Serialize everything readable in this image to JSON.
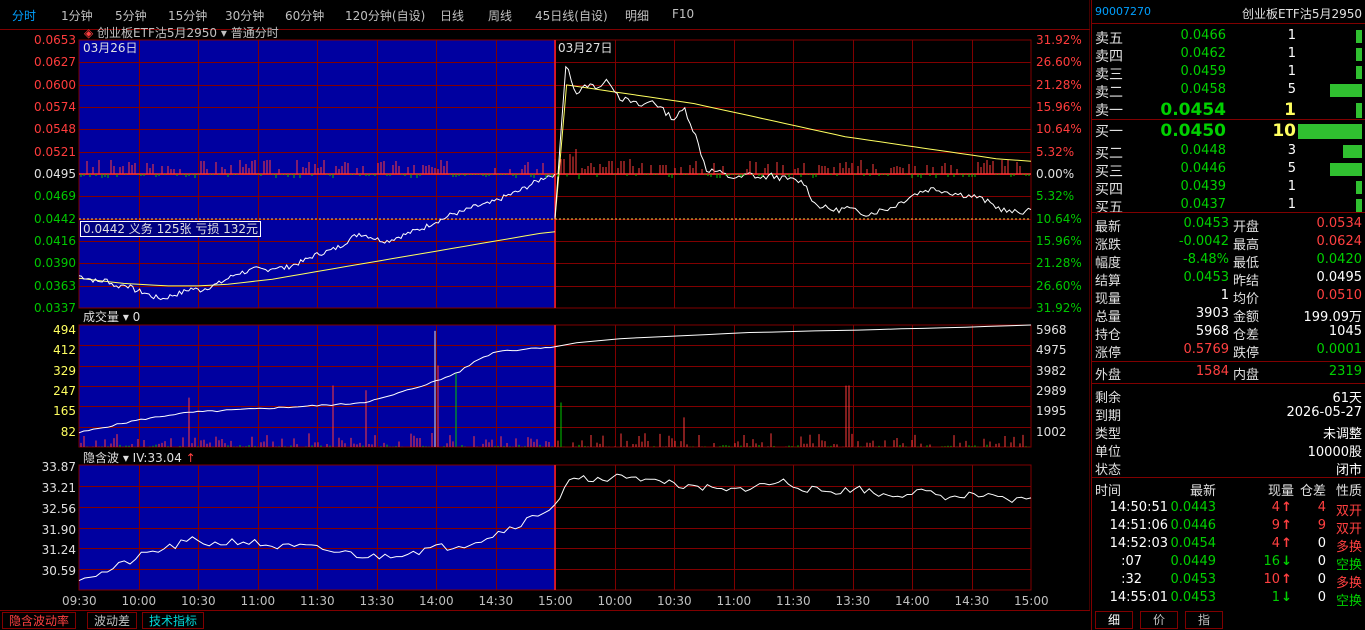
{
  "toolbar": {
    "tabs": [
      "分时",
      "1分钟",
      "5分钟",
      "15分钟",
      "30分钟",
      "60分钟",
      "120分钟(自设)",
      "日线",
      "周线",
      "45日线(自设)",
      "明细",
      "F10"
    ],
    "active": 0
  },
  "chart_header": {
    "contract_name": "创业板ETF沽5月2950",
    "mode": "普通分时",
    "date_left": "03月26日",
    "date_right": "03月27日"
  },
  "crosshair_box": "0.0442 义务 125张 亏损 132元",
  "chart_data": [
    {
      "type": "line",
      "name": "price",
      "y_ticks": [
        "0.0653",
        "0.0627",
        "0.0600",
        "0.0574",
        "0.0548",
        "0.0521",
        "0.0495",
        "0.0469",
        "0.0442",
        "0.0416",
        "0.0390",
        "0.0363",
        "0.0337"
      ],
      "pct_ticks": [
        "31.92%",
        "26.60%",
        "21.28%",
        "15.96%",
        "10.64%",
        "5.32%",
        "0.00%",
        "5.32%",
        "10.64%",
        "15.96%",
        "21.28%",
        "26.60%",
        "31.92%"
      ],
      "ylim": [
        0.0337,
        0.0653
      ],
      "prev_settle": 0.0495,
      "day1_price": [
        0.0375,
        0.0372,
        0.0368,
        0.037,
        0.0362,
        0.0365,
        0.0358,
        0.0355,
        0.035,
        0.0348,
        0.0352,
        0.0355,
        0.036,
        0.0358,
        0.0362,
        0.0366,
        0.0372,
        0.0378,
        0.038,
        0.0383,
        0.0382,
        0.0385,
        0.0384,
        0.0388,
        0.0392,
        0.0398,
        0.0402,
        0.0405,
        0.041,
        0.0418,
        0.0425,
        0.0422,
        0.0418,
        0.0416,
        0.042,
        0.0424,
        0.0428,
        0.0432,
        0.0438,
        0.0442,
        0.0448,
        0.045,
        0.0455,
        0.0458,
        0.046,
        0.0465,
        0.047,
        0.0474,
        0.048,
        0.0486,
        0.0492,
        0.0495
      ],
      "day1_avg": [
        0.0372,
        0.037,
        0.0368,
        0.0366,
        0.0365,
        0.0364,
        0.0363,
        0.0363,
        0.0363,
        0.0364,
        0.0365,
        0.0367,
        0.0369,
        0.0371,
        0.0374,
        0.0377,
        0.038,
        0.0383,
        0.0386,
        0.0389,
        0.0392,
        0.0395,
        0.0398,
        0.0401,
        0.0404,
        0.0407,
        0.041,
        0.0413,
        0.0416,
        0.0419,
        0.0422,
        0.0425,
        0.0427
      ],
      "day2_price": [
        0.0442,
        0.0624,
        0.059,
        0.06,
        0.0598,
        0.0605,
        0.0585,
        0.058,
        0.0575,
        0.0582,
        0.057,
        0.056,
        0.0572,
        0.054,
        0.05,
        0.0498,
        0.0492,
        0.049,
        0.0495,
        0.049,
        0.0493,
        0.049,
        0.0488,
        0.0485,
        0.046,
        0.0455,
        0.0452,
        0.0455,
        0.045,
        0.0448,
        0.0452,
        0.0455,
        0.0462,
        0.047,
        0.0475,
        0.0478,
        0.0475,
        0.0472,
        0.047,
        0.0468,
        0.0462,
        0.0455,
        0.045,
        0.045,
        0.0453
      ],
      "day2_avg": [
        0.0442,
        0.06,
        0.0598,
        0.0596,
        0.0594,
        0.0592,
        0.059,
        0.0588,
        0.0586,
        0.0584,
        0.0582,
        0.058,
        0.0578,
        0.0575,
        0.0572,
        0.0569,
        0.0566,
        0.0563,
        0.056,
        0.0557,
        0.0554,
        0.0551,
        0.0548,
        0.0545,
        0.0542,
        0.0539,
        0.0537,
        0.0535,
        0.0533,
        0.0531,
        0.0529,
        0.0527,
        0.0525,
        0.0523,
        0.0521,
        0.0519,
        0.0517,
        0.0515,
        0.0513,
        0.0512,
        0.0511,
        0.051
      ]
    },
    {
      "type": "bar",
      "name": "成交量",
      "label": "成交量",
      "value": "0",
      "y_ticks": [
        "494",
        "412",
        "329",
        "247",
        "165",
        "82"
      ],
      "oi_ticks": [
        "5968",
        "4975",
        "3982",
        "2989",
        "1995",
        "1002"
      ],
      "vol_max": 494,
      "oi_max": 5968,
      "oi_min": 0
    },
    {
      "type": "line",
      "name": "隐含波",
      "label": "隐含波",
      "iv_text": "IV:33.04",
      "y_ticks": [
        "33.87",
        "33.21",
        "32.56",
        "31.90",
        "31.24",
        "30.59"
      ],
      "ylim": [
        30.2,
        34.0
      ]
    }
  ],
  "time_ticks": [
    "09:30",
    "10:00",
    "10:30",
    "11:00",
    "11:30",
    "13:30",
    "14:00",
    "14:30",
    "15:00",
    "10:00",
    "10:30",
    "11:00",
    "11:30",
    "13:30",
    "14:00",
    "14:30",
    "15:00"
  ],
  "bottom_tabs": [
    "隐含波动率",
    "波动差",
    "技术指标"
  ],
  "panel": {
    "code": "90007270",
    "name": "创业板ETF沽5月2950",
    "asks": [
      {
        "label": "卖五",
        "price": "0.0466",
        "vol": "1",
        "bar": 0.1
      },
      {
        "label": "卖四",
        "price": "0.0462",
        "vol": "1",
        "bar": 0.1
      },
      {
        "label": "卖三",
        "price": "0.0459",
        "vol": "1",
        "bar": 0.1
      },
      {
        "label": "卖二",
        "price": "0.0458",
        "vol": "5",
        "bar": 0.5
      },
      {
        "label": "卖一",
        "price": "0.0454",
        "vol": "1",
        "bar": 0.1
      }
    ],
    "bids": [
      {
        "label": "买一",
        "price": "0.0450",
        "vol": "10",
        "bar": 1.0
      },
      {
        "label": "买二",
        "price": "0.0448",
        "vol": "3",
        "bar": 0.3
      },
      {
        "label": "买三",
        "price": "0.0446",
        "vol": "5",
        "bar": 0.5
      },
      {
        "label": "买四",
        "price": "0.0439",
        "vol": "1",
        "bar": 0.1
      },
      {
        "label": "买五",
        "price": "0.0437",
        "vol": "1",
        "bar": 0.1
      }
    ],
    "stats": [
      {
        "l1": "最新",
        "v1": "0.0453",
        "c1": "g",
        "l2": "开盘",
        "v2": "0.0534",
        "c2": "r"
      },
      {
        "l1": "涨跌",
        "v1": "-0.0042",
        "c1": "g",
        "l2": "最高",
        "v2": "0.0624",
        "c2": "r"
      },
      {
        "l1": "幅度",
        "v1": "-8.48%",
        "c1": "g",
        "l2": "最低",
        "v2": "0.0420",
        "c2": "g"
      },
      {
        "l1": "结算",
        "v1": "0.0453",
        "c1": "g",
        "l2": "昨结",
        "v2": "0.0495",
        "c2": "w"
      },
      {
        "l1": "现量",
        "v1": "1",
        "c1": "w",
        "l2": "均价",
        "v2": "0.0510",
        "c2": "r"
      },
      {
        "l1": "总量",
        "v1": "3903",
        "c1": "w",
        "l2": "金额",
        "v2": "199.09万",
        "c2": "w"
      },
      {
        "l1": "持仓",
        "v1": "5968",
        "c1": "w",
        "l2": "仓差",
        "v2": "1045",
        "c2": "w"
      },
      {
        "l1": "涨停",
        "v1": "0.5769",
        "c1": "r",
        "l2": "跌停",
        "v2": "0.0001",
        "c2": "g"
      }
    ],
    "outer": {
      "l1": "外盘",
      "v1": "1584",
      "l2": "内盘",
      "v2": "2319"
    },
    "info": [
      {
        "label": "剩余",
        "value": "61天"
      },
      {
        "label": "到期",
        "value": "2026-05-27"
      },
      {
        "label": "类型",
        "value": "未调整"
      },
      {
        "label": "单位",
        "value": "10000股"
      },
      {
        "label": "状态",
        "value": "闭市"
      }
    ],
    "ticks_header": [
      "时间",
      "最新",
      "现量",
      "仓差",
      "性质"
    ],
    "ticks": [
      {
        "time": "14:50:51",
        "price": "0.0443",
        "vol": "4",
        "dir": "up",
        "oi": "4",
        "nature": "双开",
        "nc": "r"
      },
      {
        "time": "14:51:06",
        "price": "0.0446",
        "vol": "9",
        "dir": "up",
        "oi": "9",
        "nature": "双开",
        "nc": "r"
      },
      {
        "time": "14:52:03",
        "price": "0.0454",
        "vol": "4",
        "dir": "up",
        "oi": "0",
        "nature": "多换",
        "nc": "r"
      },
      {
        "time": ":07",
        "price": "0.0449",
        "vol": "16",
        "dir": "down",
        "oi": "0",
        "nature": "空换",
        "nc": "g"
      },
      {
        "time": ":32",
        "price": "0.0453",
        "vol": "10",
        "dir": "up",
        "oi": "0",
        "nature": "多换",
        "nc": "r"
      },
      {
        "time": "14:55:01",
        "price": "0.0453",
        "vol": "1",
        "dir": "down",
        "oi": "0",
        "nature": "空换",
        "nc": "g"
      }
    ],
    "tabs": [
      "细",
      "价",
      "指"
    ]
  },
  "colors": {
    "up": "#ff3c3c",
    "down": "#00c800",
    "grid": "#800000",
    "day1_bg": "#0000a0",
    "avg": "#ffff60",
    "line": "#ffffff"
  }
}
